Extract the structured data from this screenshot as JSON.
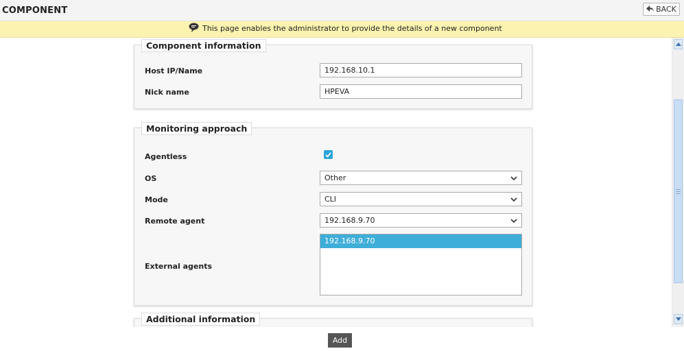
{
  "header": {
    "title": "COMPONENT",
    "back_label": "BACK"
  },
  "info": {
    "message": "This page enables the administrator to provide the details of a new component"
  },
  "component_info": {
    "legend": "Component information",
    "host_label": "Host IP/Name",
    "host_value": "192.168.10.1",
    "nick_label": "Nick name",
    "nick_value": "HPEVA"
  },
  "monitoring": {
    "legend": "Monitoring approach",
    "agentless_label": "Agentless",
    "agentless_checked": true,
    "os_label": "OS",
    "os_value": "Other",
    "mode_label": "Mode",
    "mode_value": "CLI",
    "remote_label": "Remote agent",
    "remote_value": "192.168.9.70",
    "external_label": "External agents",
    "external_items": [
      "192.168.9.70"
    ]
  },
  "additional": {
    "legend": "Additional information"
  },
  "actions": {
    "add_label": "Add"
  },
  "colors": {
    "info_bg": "#fcf3b0",
    "accent": "#3eaed9",
    "button_dark": "#555555"
  }
}
